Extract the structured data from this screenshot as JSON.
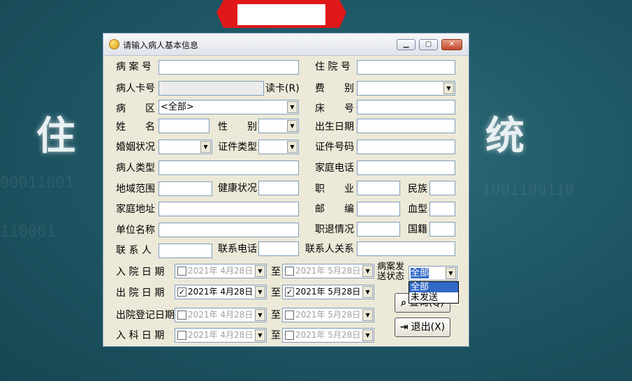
{
  "background": {
    "left_char": "住",
    "right_char": "统"
  },
  "window": {
    "title": "请输入病人基本信息",
    "min_icon": "minimize-icon",
    "max_icon": "maximize-icon",
    "close_icon": "close-icon"
  },
  "labels": {
    "case_no": "病 案 号",
    "hosp_no": "住 院 号",
    "card_no": "病人卡号",
    "read_card": "读卡(R)",
    "fee_type": "费　　别",
    "ward": "病　　区",
    "bed_no": "床　　号",
    "name": "姓　　名",
    "gender": "性　　别",
    "birth": "出生日期",
    "marital": "婚姻状况",
    "id_type": "证件类型",
    "id_no": "证件号码",
    "patient_type": "病人类型",
    "home_phone": "家庭电话",
    "region": "地域范围",
    "health": "健康状况",
    "job": "职　　业",
    "ethnic": "民族",
    "address": "家庭地址",
    "postcode": "邮　　编",
    "blood": "血型",
    "company": "单位名称",
    "retire": "职退情况",
    "nationality": "国籍",
    "contact": "联 系 人",
    "contact_phone": "联系电话",
    "contact_rel": "联系人关系",
    "admit_date": "入 院 日 期",
    "discharge_date": "出 院 日 期",
    "discharge_reg_date": "出院登记日期",
    "dept_date": "入 科 日 期",
    "to": "至",
    "send_status_1": "病案发",
    "send_status_2": "送状态"
  },
  "values": {
    "ward": "<全部>",
    "send_status": "全部"
  },
  "dates": {
    "admit_from": "2021年  4月28日",
    "admit_to": "2021年  5月28日",
    "discharge_from": "2021年  4月28日",
    "discharge_to": "2021年  5月28日",
    "reg_from": "2021年  4月28日",
    "reg_to": "2021年  5月28日",
    "dept_from": "2021年  4月28日",
    "dept_to": "2021年  5月28日"
  },
  "send_status_options": [
    "全部",
    "未发送"
  ],
  "buttons": {
    "query": "查询(Q)",
    "exit": "退出(X)"
  }
}
